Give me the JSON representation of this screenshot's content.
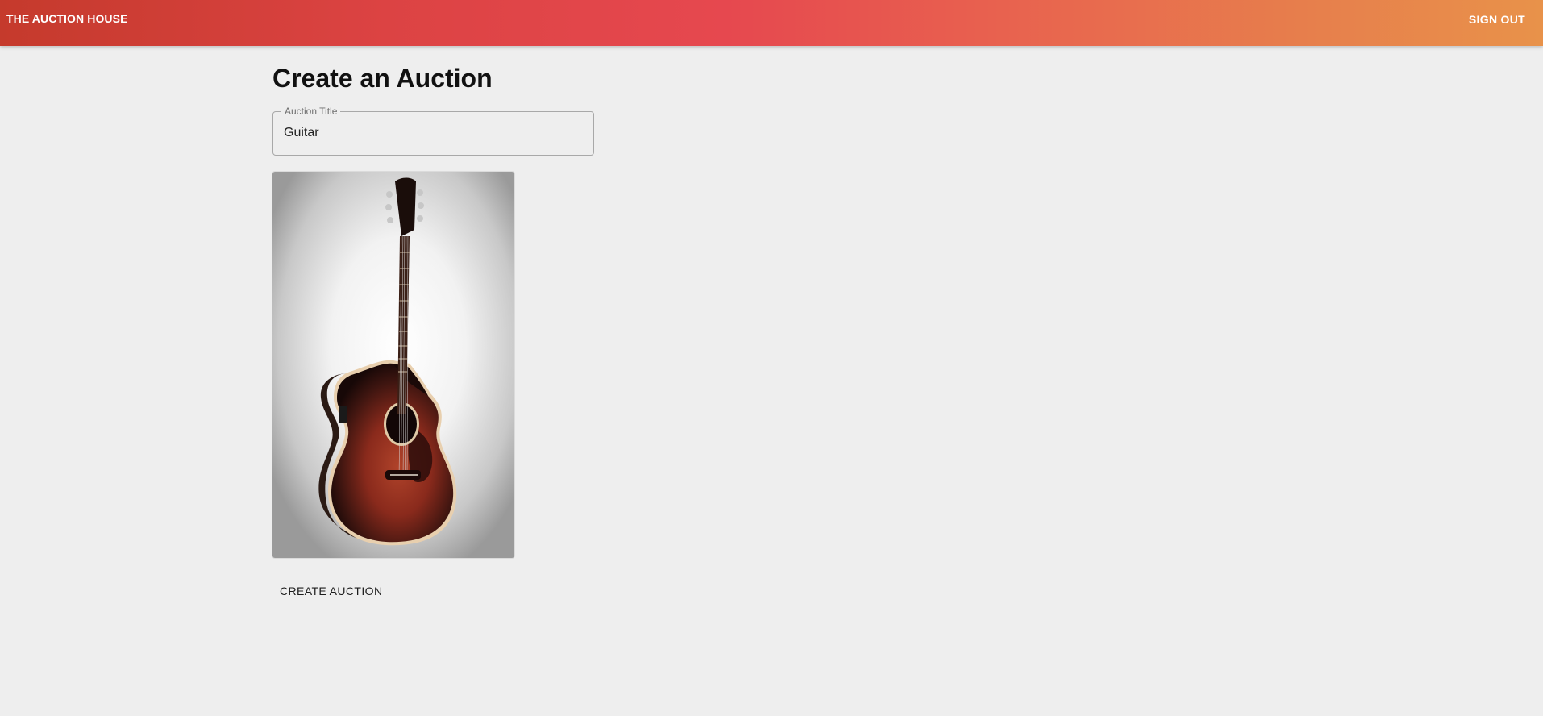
{
  "header": {
    "brand": "THE AUCTION HOUSE",
    "sign_out_label": "SIGN OUT"
  },
  "main": {
    "title": "Create an Auction",
    "title_field": {
      "label": "Auction Title",
      "value": "Guitar"
    },
    "image": {
      "subject": "acoustic guitar"
    },
    "create_button_label": "CREATE AUCTION"
  },
  "colors": {
    "header_gradient_start": "#c53a2c",
    "header_gradient_mid": "#e6484f",
    "header_gradient_end": "#e8924a",
    "page_background": "#eeeeee"
  }
}
